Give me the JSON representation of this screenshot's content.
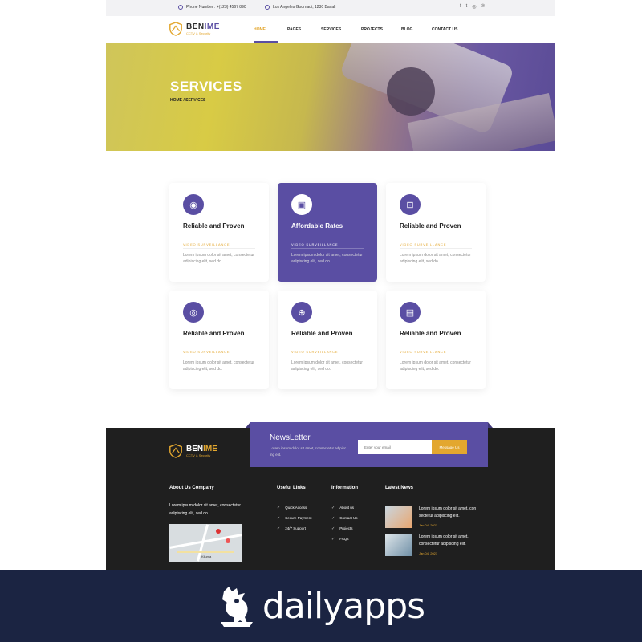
{
  "topbar": {
    "phone": "Phone Number : +(123) 4567 890",
    "address": "Los Angeles Gournadi, 1230 Bariali",
    "socials": [
      "f",
      "t",
      "◎",
      "℗"
    ]
  },
  "header": {
    "logo_name_a": "BEN",
    "logo_name_b": "IME",
    "logo_tagline": "CCTV & Security",
    "nav": [
      "HOME",
      "PAGES",
      "SERVICES",
      "PROJECTS",
      "BLOG",
      "CONTACT US"
    ]
  },
  "hero": {
    "title": "SERVICES",
    "breadcrumb": "HOME / SERVICES"
  },
  "cards": [
    {
      "title": "Reliable and Proven",
      "subtitle": "VIDEO SURVEILLANCE",
      "desc": "Lorem ipsum dolor sit amet, consectetur adipiscing elit, sed do.",
      "icon": "camera-icon",
      "glyph": "◉"
    },
    {
      "title": "Affordable Rates",
      "subtitle": "VIDEO SURVEILLANCE",
      "desc": "Lorem ipsum dolor sit amet, consectetur adipiscing elit, sed do.",
      "icon": "phone-lock-icon",
      "glyph": "▣"
    },
    {
      "title": "Reliable and Proven",
      "subtitle": "VIDEO SURVEILLANCE",
      "desc": "Lorem ipsum dolor sit amet, consectetur adipiscing elit, sed do.",
      "icon": "cctv-icon",
      "glyph": "⊡"
    },
    {
      "title": "Reliable and Proven",
      "subtitle": "VIDEO SURVEILLANCE",
      "desc": "Lorem ipsum dolor sit amet, consectetur adipiscing elit, sed do.",
      "icon": "security-check-icon",
      "glyph": "◎"
    },
    {
      "title": "Reliable and Proven",
      "subtitle": "VIDEO SURVEILLANCE",
      "desc": "Lorem ipsum dolor sit amet, consectetur adipiscing elit, sed do.",
      "icon": "dome-camera-icon",
      "glyph": "⊕"
    },
    {
      "title": "Reliable and Proven",
      "subtitle": "VIDEO SURVEILLANCE",
      "desc": "Lorem ipsum dolor sit amet, consectetur adipiscing elit, sed do.",
      "icon": "monitor-icon",
      "glyph": "▤"
    }
  ],
  "newsletter": {
    "title": "NewsLetter",
    "text": "Lorem ipsum dolor sit amet, consectetur adipisc ing elit.",
    "placeholder": "Enter your email",
    "button": "Message Us"
  },
  "footer": {
    "logo_name_a": "BEN",
    "logo_name_b": "IME",
    "logo_tagline": "CCTV & Security",
    "about_title": "About Us Company",
    "about_text": "Lorem ipsum dolor sit amet, consectetur adipiscing elit, sed do.",
    "useful_title": "Useful Links",
    "useful_links": [
      "Quick Access",
      "Secure Payment",
      "24/7 Support"
    ],
    "info_title": "Information",
    "info_links": [
      "About us",
      "Contact Us",
      "Projects",
      "FAQs"
    ],
    "news_title": "Latest News",
    "news": [
      {
        "text": "Lorem ipsum dolor sit amet, con sectetur adipiscing elit.",
        "date": "Jan 04, 2021"
      },
      {
        "text": "Lorem ipsum dolor sit amet, consectetur adipiscing elit.",
        "date": "Jan 04, 2021"
      }
    ],
    "map_label": "Kiluma"
  },
  "brand": {
    "name": "dailyapps"
  },
  "colors": {
    "accent": "#5a4ea3",
    "highlight": "#e3a72f",
    "footer_bg": "#1f1f1f",
    "brand_bg": "#1b2442"
  }
}
